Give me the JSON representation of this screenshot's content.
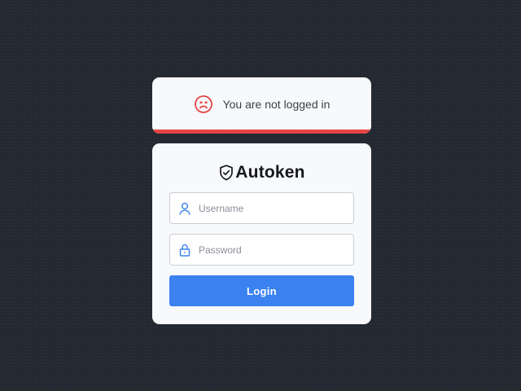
{
  "notice": {
    "icon": "sad-face-icon",
    "text": "You are not logged in",
    "accent_color": "#e54545"
  },
  "login": {
    "logo_icon": "shield-check-icon",
    "brand_name": "Autoken",
    "username": {
      "icon": "user-icon",
      "placeholder": "Username",
      "value": ""
    },
    "password": {
      "icon": "lock-icon",
      "placeholder": "Password",
      "value": ""
    },
    "submit_label": "Login",
    "button_color": "#3b82f0"
  }
}
